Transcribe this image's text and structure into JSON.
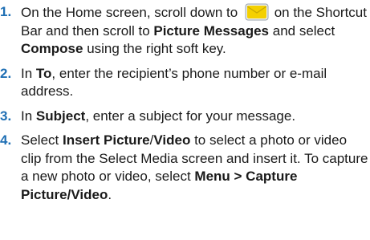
{
  "steps": [
    {
      "number": "1.",
      "parts": {
        "t1": "On the Home screen, scroll down to ",
        "t2": " on the Shortcut Bar and then scroll to ",
        "b1": "Picture Messages",
        "t3": " and select ",
        "b2": "Compose",
        "t4": " using the right soft key."
      },
      "icon": "envelope-icon"
    },
    {
      "number": "2.",
      "parts": {
        "b1": "To",
        "t1": ", enter the recipient’s phone number or e-mail address."
      }
    },
    {
      "number": "3.",
      "parts": {
        "t0": "In ",
        "b1": "Subject",
        "t1": ", enter a subject for your message."
      }
    },
    {
      "number": "4.",
      "parts": {
        "t0": "Select ",
        "b1": "Insert Picture",
        "t1": "/",
        "b2": "Video",
        "t2": " to select a photo or video clip from the Select Media screen and insert it. To capture a new photo or video, select ",
        "b3": "Menu > Capture Picture/Video",
        "t3": "."
      }
    }
  ],
  "colors": {
    "step_number": "#1f6fb4",
    "icon_fill": "#f4d000",
    "icon_border": "#9aa3ab"
  }
}
